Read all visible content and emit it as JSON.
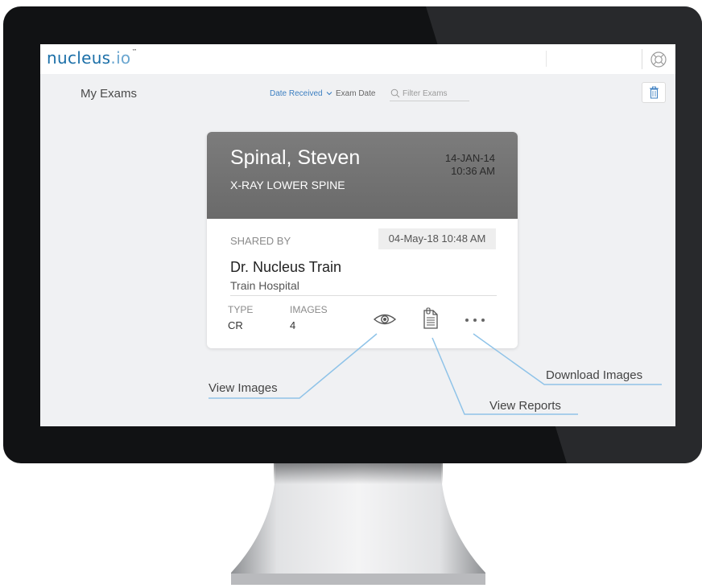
{
  "app": {
    "logo_main": "nucleus",
    "logo_suffix": ".io",
    "logo_tm": "™"
  },
  "toolbar": {
    "title": "My Exams",
    "sort_date_received": "Date Received",
    "sort_exam_date": "Exam Date",
    "filter_placeholder": "Filter Exams"
  },
  "exam": {
    "patient_name": "Spinal, Steven",
    "study_description": "X-RAY LOWER SPINE",
    "study_date": "14-JAN-14",
    "study_time": "10:36 AM",
    "shared_by_label": "SHARED BY",
    "shared_date": "04-May-18 10:48 AM",
    "shared_by_name": "Dr. Nucleus Train",
    "shared_by_org": "Train Hospital",
    "type_label": "TYPE",
    "type_value": "CR",
    "images_label": "IMAGES",
    "images_value": "4"
  },
  "callouts": {
    "view_images": "View Images",
    "view_reports": "View Reports",
    "download_images": "Download Images"
  },
  "colors": {
    "accent": "#3c7fc1",
    "callout_line": "#8fc3e8",
    "card_header": "#737373"
  },
  "icons": {
    "help": "lifebuoy-icon",
    "trash": "trash-icon",
    "search": "search-icon",
    "view": "eye-icon",
    "report": "document-icon",
    "more": "ellipsis-icon"
  }
}
